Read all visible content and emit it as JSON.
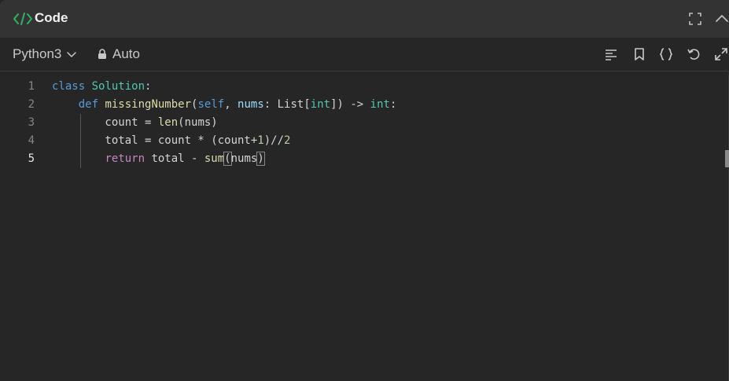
{
  "panel": {
    "title": "Code",
    "icons": [
      "code-brackets-icon",
      "fullscreen-icon",
      "collapse-chevron-icon"
    ]
  },
  "toolbar": {
    "language": "Python3",
    "mode": "Auto",
    "icons": [
      "format-icon",
      "bookmark-icon",
      "braces-icon",
      "reset-icon",
      "expand-icon"
    ]
  },
  "editor": {
    "line_numbers": [
      "1",
      "2",
      "3",
      "4",
      "5"
    ],
    "active_line": 5,
    "lines": [
      [
        {
          "t": "class",
          "c": "kw"
        },
        {
          "t": " "
        },
        {
          "t": "Solution",
          "c": "cls"
        },
        {
          "t": ":"
        }
      ],
      [
        {
          "t": "    "
        },
        {
          "t": "def",
          "c": "kw"
        },
        {
          "t": " "
        },
        {
          "t": "missingNumber",
          "c": "fn"
        },
        {
          "t": "("
        },
        {
          "t": "self",
          "c": "kw"
        },
        {
          "t": ", "
        },
        {
          "t": "nums",
          "c": "prm"
        },
        {
          "t": ": "
        },
        {
          "t": "List",
          "c": ""
        },
        {
          "t": "["
        },
        {
          "t": "int",
          "c": "cls"
        },
        {
          "t": "]) -> "
        },
        {
          "t": "int",
          "c": "cls"
        },
        {
          "t": ":"
        }
      ],
      [
        {
          "t": "        count = "
        },
        {
          "t": "len",
          "c": "fn"
        },
        {
          "t": "(nums)"
        }
      ],
      [
        {
          "t": "        total = count * (count+"
        },
        {
          "t": "1",
          "c": "num"
        },
        {
          "t": ")//"
        },
        {
          "t": "2",
          "c": "num"
        }
      ],
      [
        {
          "t": "        "
        },
        {
          "t": "return",
          "c": "ctl"
        },
        {
          "t": " total - "
        },
        {
          "t": "sum",
          "c": "fn"
        },
        {
          "t": "(",
          "c": "bracket"
        },
        {
          "t": "nums"
        },
        {
          "t": ")",
          "c": "bracket"
        }
      ]
    ]
  },
  "colors": {
    "accent_green": "#2db55d",
    "keyword": "#569cd6",
    "class": "#4ec9b0",
    "function": "#dcdcaa",
    "param": "#9cdcfe",
    "number": "#b5cea8",
    "control": "#c586c0"
  }
}
